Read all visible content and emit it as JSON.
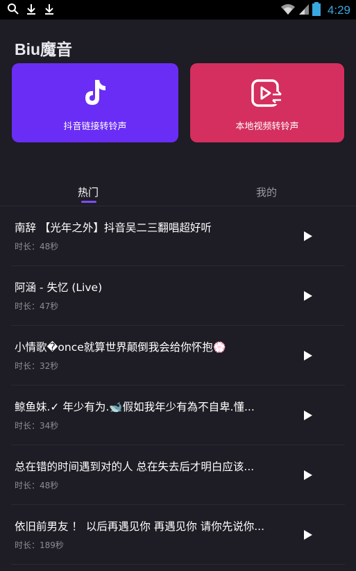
{
  "status_bar": {
    "time": "4:29",
    "left_icons": [
      "search-icon",
      "download-icon",
      "download-icon"
    ],
    "right_icons": [
      "wifi-icon",
      "signal-icon",
      "battery-icon"
    ]
  },
  "app": {
    "title": "Biu魔音"
  },
  "cards": {
    "left": {
      "label": "抖音链接转铃声",
      "icon": "tiktok-icon",
      "color": "#6a2df5"
    },
    "right": {
      "label": "本地视频转铃声",
      "icon": "video-convert-icon",
      "color": "#d42f5e"
    }
  },
  "tabs": {
    "hot": "热门",
    "mine": "我的",
    "active": "hot",
    "indicator_color": "#7b4dff"
  },
  "songs": [
    {
      "title": "南辞 【光年之外】抖音吴二三翻唱超好听",
      "duration": "时长：48秒"
    },
    {
      "title": "阿涵 - 失忆 (Live)",
      "duration": "时长：47秒"
    },
    {
      "title": "小情歌�once就算世界颠倒我会给你怀抱💮",
      "duration": "时长：32秒"
    },
    {
      "title": "鲸鱼妹.✓ 年少有为.🐋假如我年少有為不自卑.懂...",
      "duration": "时长：34秒"
    },
    {
      "title": "总在错的时间遇到对的人 总在失去后才明白应该...",
      "duration": "时长：48秒"
    },
    {
      "title": "依旧前男友 ！ 以后再遇见你 再遇见你 请你先说你...",
      "duration": "时长：189秒"
    }
  ]
}
